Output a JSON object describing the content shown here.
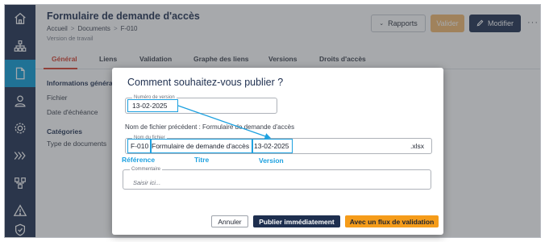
{
  "header": {
    "title": "Formulaire de demande d'accès",
    "breadcrumb": [
      "Accueil",
      "Documents",
      "F-010"
    ],
    "breadcrumb_separator": ">",
    "version_note": "Version de travail",
    "rapports_label": "Rapports",
    "valider_label": "Valider",
    "modifier_label": "Modifier",
    "more_label": "···"
  },
  "tabs": [
    "Général",
    "Liens",
    "Validation",
    "Graphe des liens",
    "Versions",
    "Droits d'accès"
  ],
  "info": {
    "section_title": "Informations générales",
    "file_label": "Fichier",
    "due_label": "Date d'échéance",
    "categories_title": "Catégories",
    "doc_types_label": "Type de documents"
  },
  "sidebar": {
    "icons": [
      "home-icon",
      "sitemap-icon",
      "document-icon",
      "user-icon",
      "settings-icon",
      "process-icon",
      "org-chart-icon",
      "warning-icon",
      "shield-icon"
    ],
    "active_index": 2
  },
  "modal": {
    "title": "Comment souhaitez-vous publier ?",
    "version_field": {
      "legend": "Numéro de version",
      "value": "13-02-2025"
    },
    "previous_filename": "Nom de fichier précédent : Formulaire de demande d'accès",
    "filename_field": {
      "legend": "Nom du fichier",
      "reference": "F-010",
      "title": "Formulaire de demande d'accès",
      "version": "13-02-2025",
      "extension": ".xlsx"
    },
    "annotations": {
      "reference": "Référence",
      "title": "Titre",
      "version": "Version"
    },
    "comment_field": {
      "legend": "Commentaire",
      "placeholder": "Saisir ici..."
    },
    "buttons": {
      "cancel": "Annuler",
      "publish_now": "Publier immédiatement",
      "with_flow": "Avec un flux de validation"
    }
  },
  "colors": {
    "sidebar": "#1e2f4f",
    "sidebar_active": "#0a9bd6",
    "accent_tab": "#d6402e",
    "annotation": "#1da1e0",
    "publish_button": "#1e2f4f",
    "flow_button": "#f59c1a",
    "valider_button": "#f2b86d"
  }
}
